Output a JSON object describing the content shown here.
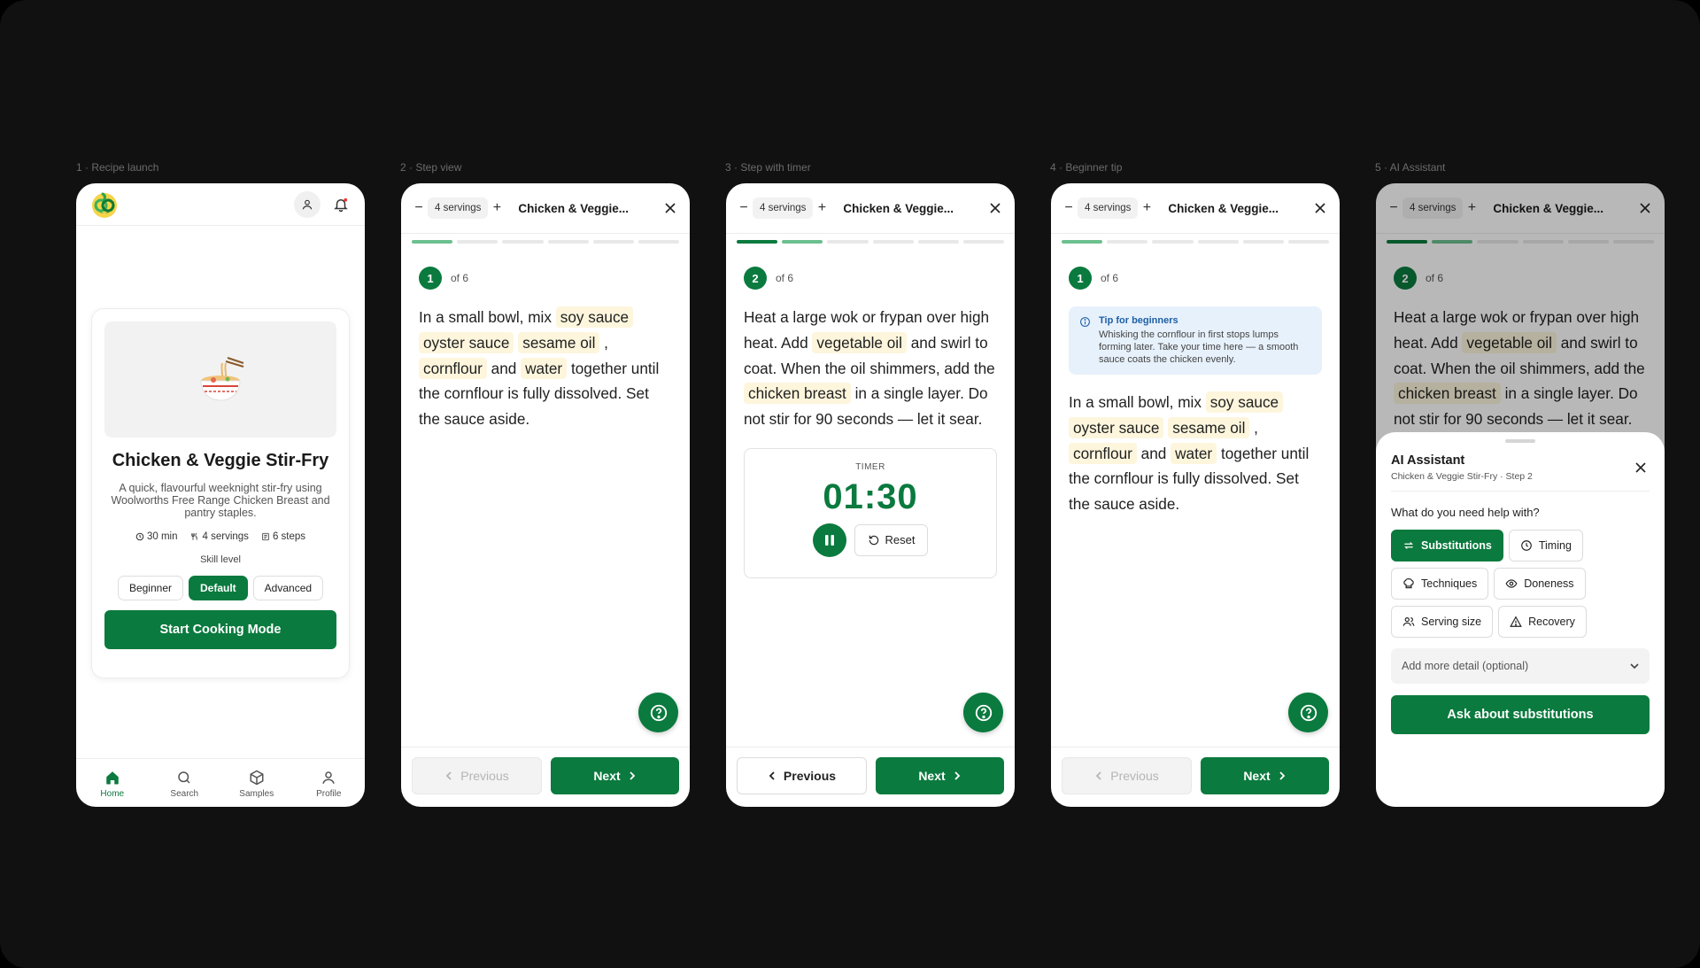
{
  "frames": {
    "f1": "1 · Recipe launch",
    "f2": "2 · Step view",
    "f3": "3 · Step with timer",
    "f4": "4 · Beginner tip",
    "f5": "5 · AI Assistant"
  },
  "recipe": {
    "title": "Chicken & Veggie Stir-Fry",
    "short_title": "Chicken & Veggie...",
    "description": "A quick, flavourful weeknight stir-fry using Woolworths Free Range Chicken Breast and pantry staples.",
    "time": "30 min",
    "servings": "4 servings",
    "steps": "6 steps",
    "skill_label": "Skill level",
    "skills": [
      "Beginner",
      "Default",
      "Advanced"
    ],
    "skill_selected": "Default",
    "start_label": "Start Cooking Mode"
  },
  "nav": {
    "home": "Home",
    "search": "Search",
    "samples": "Samples",
    "profile": "Profile"
  },
  "header": {
    "servings": "4 servings"
  },
  "step1": {
    "number": "1",
    "of": "of 6",
    "t1": "In a small bowl, mix ",
    "i1": "soy sauce",
    "i2": "oyster sauce",
    "i3": "sesame oil",
    "t2": ",",
    "i4": "cornflour",
    "t3": "and",
    "i5": "water",
    "t4": "together until the cornflour is fully dissolved. Set the sauce aside."
  },
  "step2": {
    "number": "2",
    "of": "of 6",
    "t1": "Heat a large wok or frypan over high heat. Add ",
    "i1": "vegetable oil",
    "t2": " and swirl to coat. When the oil shimmers, add the ",
    "i2": "chicken breast",
    "t3": " in a single layer. Do not stir for 90 seconds — let it sear."
  },
  "timer": {
    "label": "TIMER",
    "value": "01:30",
    "reset": "Reset"
  },
  "tip": {
    "title": "Tip for beginners",
    "text": "Whisking the cornflour in first stops lumps forming later. Take your time here — a smooth sauce coats the chicken evenly."
  },
  "footer": {
    "previous": "Previous",
    "next": "Next"
  },
  "assistant": {
    "title": "AI Assistant",
    "subtitle": "Chicken & Veggie Stir-Fry · Step 2",
    "question": "What do you need help with?",
    "chips": [
      "Substitutions",
      "Timing",
      "Techniques",
      "Doneness",
      "Serving size",
      "Recovery"
    ],
    "chip_selected": "Substitutions",
    "detail_placeholder": "Add more detail (optional)",
    "ask_label": "Ask about substitutions"
  },
  "colors": {
    "brand": "#0a7a3e",
    "ingredient_highlight": "#fdf6dd",
    "tip_background": "#e7f1fb"
  }
}
